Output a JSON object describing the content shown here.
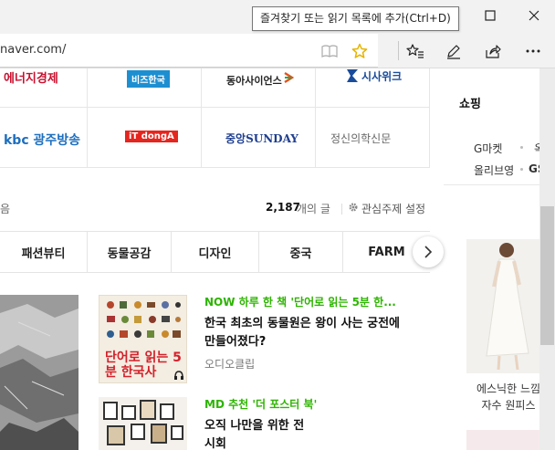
{
  "browser": {
    "url": "naver.com/",
    "tooltip": "즐겨찾기 또는 읽기 목록에 추가(Ctrl+D)"
  },
  "icons": {
    "reading_view": "book-icon",
    "favorite": "star-icon",
    "favorites_list": "star-list-icon",
    "notes": "pen-icon",
    "share": "share-icon",
    "more": "more-icon",
    "minimize": "minimize-icon",
    "maximize": "maximize-icon",
    "close": "close-icon",
    "next": "chevron-right-icon",
    "settings": "gear-icon",
    "audio": "headphones-icon"
  },
  "colors": {
    "accent_green": "#2db400",
    "favorite_star": "#e6b400"
  },
  "press_logos": [
    "에너지경제",
    "비즈한국",
    "동아사이언스",
    "시사위크",
    "kbc 광주방송",
    "iT dongA",
    "중앙SUNDAY",
    "정신의학신문"
  ],
  "subscribe_row": {
    "left_fragment": "음",
    "count": "2,187",
    "count_suffix": "개의 글",
    "settings_label": "관심주제 설정"
  },
  "categories": [
    "패션뷰티",
    "동물공감",
    "디자인",
    "중국",
    "FARM"
  ],
  "cards": [
    {
      "tag": "NOW 하루 한 책 '단어로 읽는 5분 한...",
      "title": "한국 최초의 동물원은 왕이 사는 궁전에 만들어졌다?",
      "source": "오디오클립",
      "cover_text": "단어로 읽는 5분 한국사"
    },
    {
      "tag": "MD 추천 '더 포스터 북'",
      "title": "오직 나만을 위한 전시회",
      "source": ""
    }
  ],
  "shopping": {
    "title": "쇼핑",
    "links": [
      "G마켓",
      "옥션",
      "올리브영",
      "GS"
    ],
    "product_caption": "에스닉한 느낌 자수 원피스"
  }
}
